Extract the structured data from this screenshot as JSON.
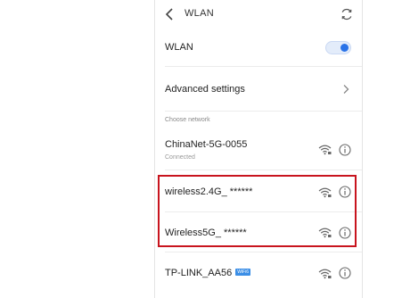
{
  "header": {
    "title": "WLAN"
  },
  "wlan_toggle": {
    "label": "WLAN",
    "state": "on"
  },
  "advanced": {
    "label": "Advanced settings"
  },
  "section": {
    "title": "Choose network"
  },
  "networks": [
    {
      "ssid": "ChinaNet-5G-0055",
      "status": "Connected"
    },
    {
      "ssid": "wireless2.4G_ ******"
    },
    {
      "ssid": "Wireless5G_ ******"
    },
    {
      "ssid": "TP-LINK_AA56",
      "badge": "WiFi6"
    }
  ],
  "colors": {
    "accent": "#2a73e8",
    "highlight": "#c8141e",
    "badge": "#3b8ee6"
  }
}
